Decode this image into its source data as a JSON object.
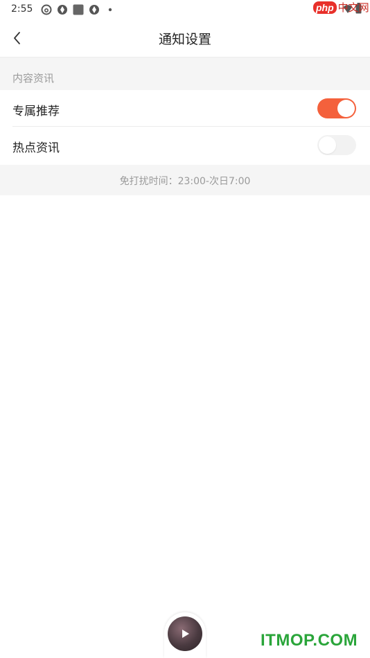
{
  "status_bar": {
    "time": "2:55",
    "icons": [
      "netease-music-icon",
      "aperture-icon",
      "square-app-icon",
      "aperture-icon",
      "dot-icon"
    ],
    "right_icons": [
      "wifi-icon",
      "battery-icon"
    ]
  },
  "watermark_top": {
    "badge": "php",
    "text": "中文网"
  },
  "nav": {
    "back_icon": "chevron-left-icon",
    "title": "通知设置"
  },
  "section": {
    "header": "内容资讯",
    "items": [
      {
        "label": "专属推荐",
        "enabled": true
      },
      {
        "label": "热点资讯",
        "enabled": false
      }
    ]
  },
  "footer_note": "免打扰时间：23:00-次日7:00",
  "play_widget": {
    "icon": "play-icon"
  },
  "watermark_bottom": "ITMOP.COM",
  "colors": {
    "accent": "#f4613c",
    "section_bg": "#f5f5f5",
    "muted_text": "#9a9a9a"
  }
}
